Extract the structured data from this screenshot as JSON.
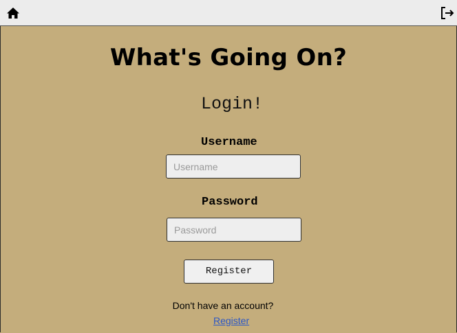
{
  "nav": {
    "home_icon": "home-icon",
    "logout_icon": "logout-icon"
  },
  "page": {
    "title": "What's Going On?",
    "subtitle": "Login!"
  },
  "form": {
    "username_label": "Username",
    "username_placeholder": "Username",
    "username_value": "",
    "password_label": "Password",
    "password_placeholder": "Password",
    "password_value": "",
    "submit_label": "Register"
  },
  "footer": {
    "prompt": "Don't have an account?",
    "link_label": "Register"
  },
  "colors": {
    "background": "#c4ad7c",
    "topbar": "#ececec",
    "link": "#2a56c6"
  }
}
